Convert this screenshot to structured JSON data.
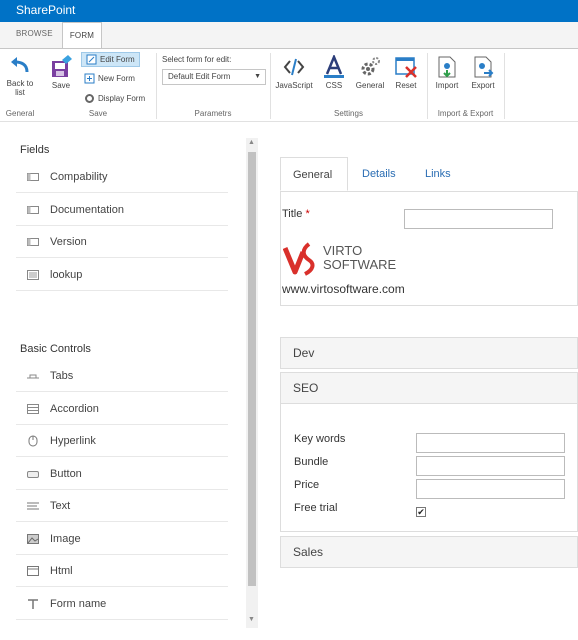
{
  "suitebar": {
    "brand": "SharePoint"
  },
  "ribbon_tabs": {
    "browse": "BROWSE",
    "form": "FORM"
  },
  "ribbon": {
    "back": "Back to list",
    "save": "Save",
    "edit_form": "Edit Form",
    "new_form": "New Form",
    "display_form": "Display Form",
    "select_label": "Select form for edit:",
    "select_value": "Default Edit Form",
    "javascript": "JavaScript",
    "css": "CSS",
    "general": "General",
    "reset": "Reset",
    "import": "Import",
    "export": "Export",
    "groups": {
      "general": "General",
      "save": "Save",
      "params": "Parametrs",
      "settings": "Settings",
      "import_export": "Import & Export"
    }
  },
  "fields": {
    "heading": "Fields",
    "items": [
      {
        "label": "Compability",
        "icon": "field-icon"
      },
      {
        "label": "Documentation",
        "icon": "field-icon"
      },
      {
        "label": "Version",
        "icon": "field-icon"
      },
      {
        "label": "lookup",
        "icon": "lookup-icon"
      }
    ]
  },
  "basic_controls": {
    "heading": "Basic Controls",
    "items": [
      {
        "label": "Tabs",
        "icon": "tabs-icon"
      },
      {
        "label": "Accordion",
        "icon": "accordion-icon"
      },
      {
        "label": "Hyperlink",
        "icon": "hyperlink-icon"
      },
      {
        "label": "Button",
        "icon": "button-icon"
      },
      {
        "label": "Text",
        "icon": "text-icon"
      },
      {
        "label": "Image",
        "icon": "image-icon"
      },
      {
        "label": "Html",
        "icon": "html-icon"
      },
      {
        "label": "Form name",
        "icon": "form-name-icon"
      }
    ]
  },
  "main": {
    "tabs": [
      "General",
      "Details",
      "Links"
    ],
    "title_label": "Title",
    "required_mark": "*",
    "logo_line1": "VIRTO",
    "logo_line2": "SOFTWARE",
    "url": "www.virtosoftware.com",
    "sections": {
      "dev": "Dev",
      "seo": "SEO",
      "sales": "Sales"
    },
    "seo_fields": {
      "keywords": "Key words",
      "bundle": "Bundle",
      "price": "Price",
      "free_trial": "Free trial"
    },
    "free_trial_checked": true
  },
  "colors": {
    "suitebar": "#0072c6",
    "link": "#2a6db3",
    "required": "#cc0000"
  }
}
